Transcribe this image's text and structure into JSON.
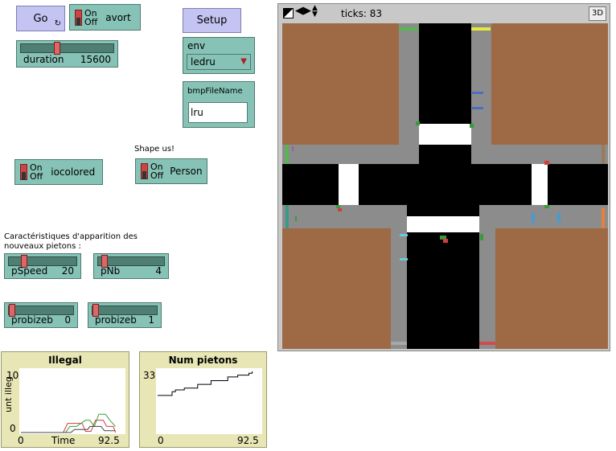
{
  "buttons": {
    "go_label": "Go",
    "go_loop_icon": "forever-icon",
    "setup_label": "Setup"
  },
  "switches": {
    "avort": {
      "on_label": "On",
      "off_label": "Off",
      "label": "avort"
    },
    "iocolored": {
      "on_label": "On",
      "off_label": "Off",
      "label": "iocolored"
    },
    "person": {
      "on_label": "On",
      "off_label": "Off",
      "label": "Person"
    }
  },
  "sliders": {
    "duration": {
      "label": "duration",
      "value": "15600",
      "fraction": 0.38
    },
    "pSpeed": {
      "label": "pSpeed",
      "value": "20",
      "fraction": 0.2
    },
    "pNb": {
      "label": "pNb",
      "value": "4",
      "fraction": 0.05
    },
    "probizeb0": {
      "label": "probizeb",
      "value": "0",
      "fraction": 0.0
    },
    "probizeb1": {
      "label": "probizeb",
      "value": "1",
      "fraction": 0.0
    }
  },
  "chooser": {
    "label": "env",
    "value": "ledru"
  },
  "input": {
    "label": "bmpFileName",
    "value": "lru"
  },
  "notes": {
    "shape": "Shape us!",
    "characteristics": "Caractéristiques d'apparition des nouveaux pietons :"
  },
  "view": {
    "ticks_label": "ticks: 83",
    "btn_3d": "3D",
    "controls": [
      "edit-icon",
      "left-right-arrows-icon",
      "up-down-arrows-icon"
    ]
  },
  "plots": {
    "illegal": {
      "title": "Illegal",
      "ylabel": "unt illeg",
      "ymax_label": "10",
      "ymin_label": "0",
      "xmin_label": "0",
      "xlabel": "Time",
      "xmax_label": "92.5"
    },
    "num": {
      "title": "Num pietons",
      "ymax_label": "33",
      "xmin_label": "0",
      "xmax_label": "92.5"
    }
  },
  "chart_data": [
    {
      "type": "line",
      "title": "Illegal",
      "xlabel": "Time",
      "ylabel": "unt illeg",
      "xlim": [
        0,
        92.5
      ],
      "ylim": [
        0,
        10
      ],
      "series": [
        {
          "color": "#d23c3c",
          "x": [
            0,
            38,
            42,
            47,
            55,
            58,
            63,
            67,
            74,
            77,
            83,
            85
          ],
          "y": [
            0,
            0,
            1.5,
            1.5,
            1.5,
            0.2,
            0.2,
            2,
            2,
            1,
            1,
            0
          ]
        },
        {
          "color": "#3aa03a",
          "x": [
            0,
            40,
            44,
            50,
            58,
            62,
            66,
            70,
            76,
            80,
            85
          ],
          "y": [
            0,
            0,
            1,
            1,
            2,
            2,
            1,
            3,
            3,
            2,
            1
          ]
        },
        {
          "color": "#444444",
          "x": [
            0,
            45,
            48,
            60,
            62,
            72,
            75,
            85
          ],
          "y": [
            0,
            0,
            0.5,
            0.5,
            1,
            1,
            0.3,
            0.3
          ]
        }
      ]
    },
    {
      "type": "line",
      "title": "Num pietons",
      "xlim": [
        0,
        92.5
      ],
      "ylim": [
        0,
        33
      ],
      "series": [
        {
          "color": "#000000",
          "x": [
            0,
            13,
            13,
            16,
            16,
            24,
            24,
            36,
            36,
            48,
            48,
            63,
            63,
            72,
            72,
            82,
            82,
            85,
            85
          ],
          "y": [
            20,
            20,
            22,
            22,
            23,
            23,
            24,
            24,
            26,
            26,
            28,
            28,
            30,
            30,
            31,
            31,
            32,
            32,
            33
          ]
        }
      ]
    }
  ]
}
